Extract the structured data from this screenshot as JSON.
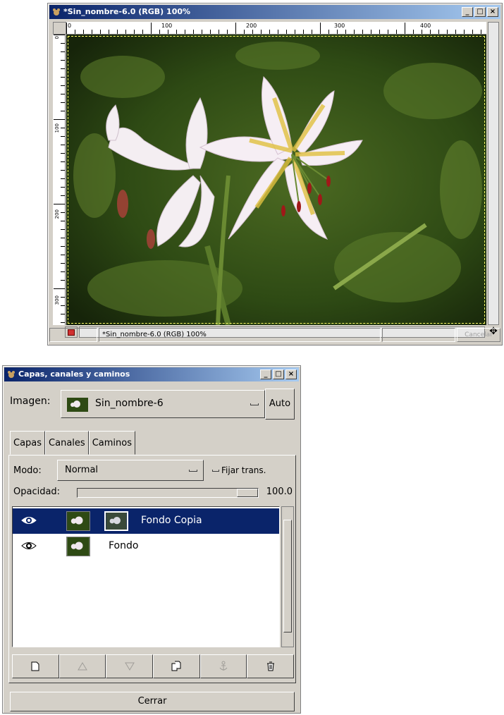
{
  "image_window": {
    "title": "*Sin_nombre-6.0 (RGB) 100%",
    "ruler_labels": [
      "0",
      "100",
      "200",
      "300",
      "400"
    ],
    "status_text": "*Sin_nombre-6.0 (RGB) 100%",
    "cancel_label": "Cancelar"
  },
  "layers_window": {
    "title": "Capas, canales y caminos",
    "image_label": "Imagen:",
    "image_name": "Sin_nombre-6",
    "auto_label": "Auto",
    "tabs": [
      {
        "label": "Capas"
      },
      {
        "label": "Canales"
      },
      {
        "label": "Caminos"
      }
    ],
    "mode_label": "Modo:",
    "mode_value": "Normal",
    "keep_trans_label": "Fijar trans.",
    "opacity_label": "Opacidad:",
    "opacity_value": "100.0",
    "layers": [
      {
        "name": "Fondo Copia",
        "selected": true
      },
      {
        "name": "Fondo",
        "selected": false
      }
    ],
    "close_label": "Cerrar"
  },
  "colors": {
    "titlebar_active": "#0a246a",
    "selection": "#0a246a",
    "window_bg": "#d4d0c8"
  }
}
